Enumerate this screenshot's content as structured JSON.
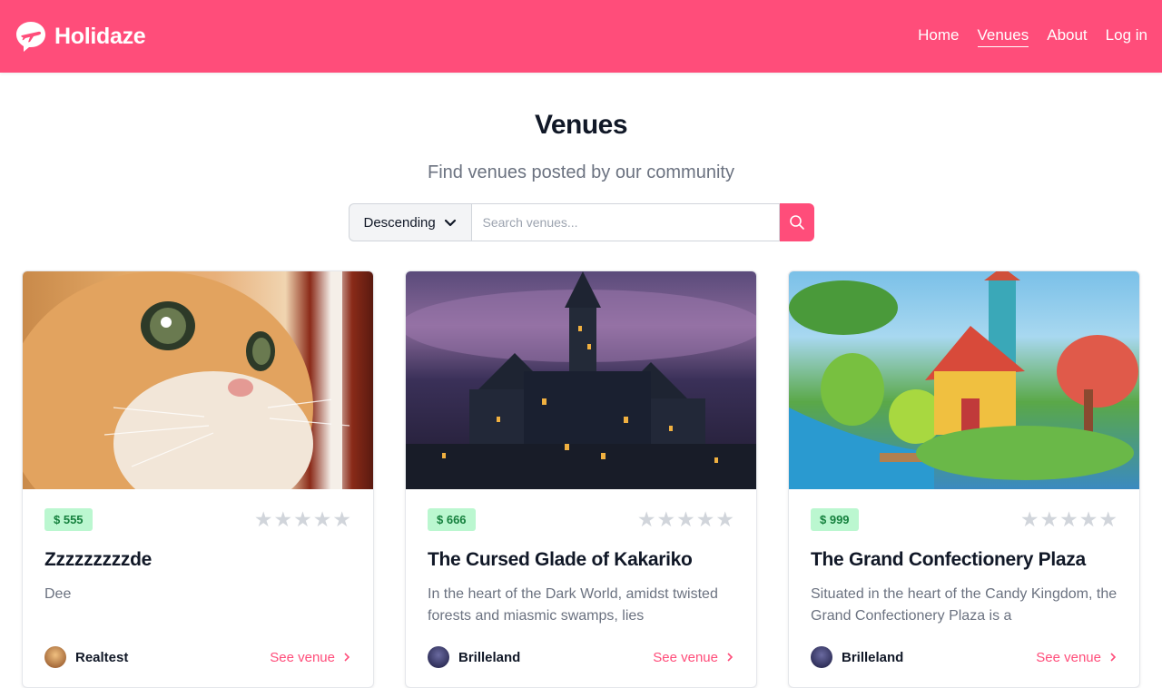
{
  "brand": {
    "name": "Holidaze",
    "color": "#ff4d7a"
  },
  "nav": [
    {
      "label": "Home",
      "active": false
    },
    {
      "label": "Venues",
      "active": true
    },
    {
      "label": "About",
      "active": false
    },
    {
      "label": "Log in",
      "active": false
    }
  ],
  "page": {
    "title": "Venues",
    "subtitle": "Find venues posted by our community"
  },
  "search": {
    "sort_value": "Descending",
    "placeholder": "Search venues..."
  },
  "venues": [
    {
      "price": "$ 555",
      "rating": 0,
      "name": "Zzzzzzzzzde",
      "description": "Dee",
      "owner": "Realtest",
      "link": "See venue",
      "image": "orange-kitten-photo"
    },
    {
      "price": "$ 666",
      "rating": 0,
      "name": "The Cursed Glade of Kakariko",
      "description": "In the heart of the Dark World, amidst twisted forests and miasmic swamps, lies",
      "owner": "Brilleland",
      "link": "See venue",
      "image": "dark-village-illustration"
    },
    {
      "price": "$ 999",
      "rating": 0,
      "name": "The Grand Confectionery Plaza",
      "description": "Situated in the heart of the Candy Kingdom, the Grand Confectionery Plaza is a",
      "owner": "Brilleland",
      "link": "See venue",
      "image": "candy-house-illustration"
    }
  ]
}
